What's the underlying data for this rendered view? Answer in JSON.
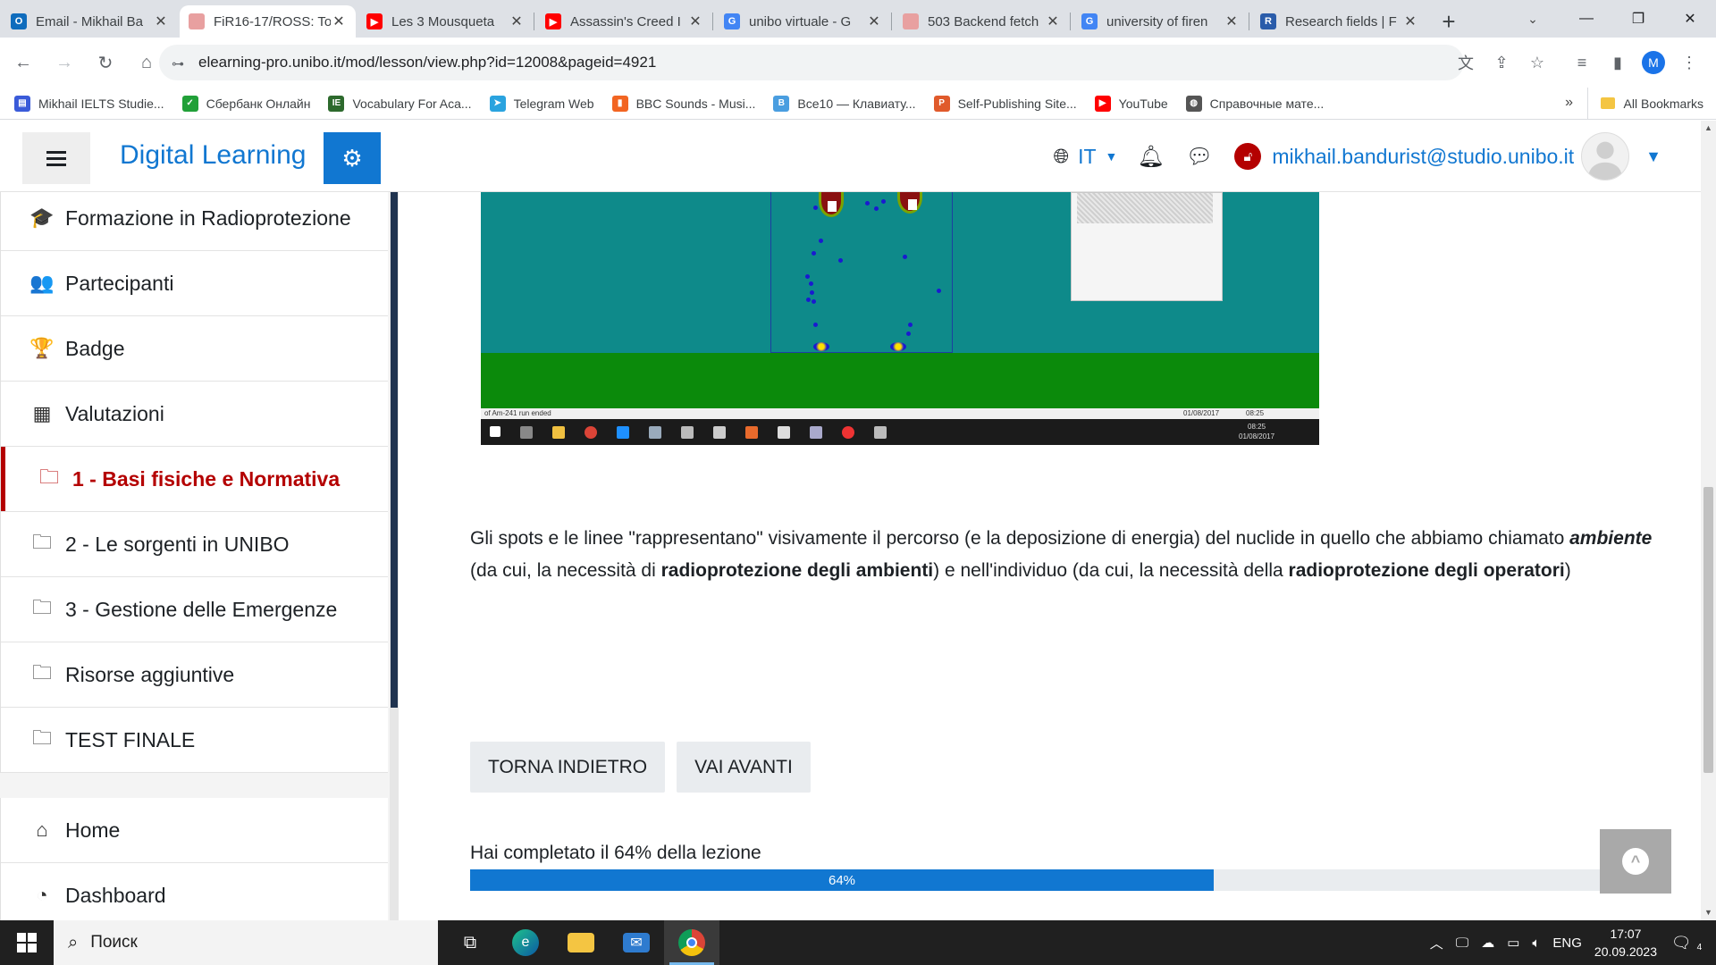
{
  "browser": {
    "tabs": [
      {
        "title": "Email - Mikhail Ba",
        "favicon_color": "#0f6cbd",
        "favicon_letter": "O",
        "active": false
      },
      {
        "title": "FiR16-17/ROSS: To",
        "favicon_color": "#e8a0a0",
        "favicon_letter": "",
        "active": true
      },
      {
        "title": "Les 3 Mousqueta",
        "favicon_color": "#ff0000",
        "favicon_letter": "▶",
        "active": false
      },
      {
        "title": "Assassin's Creed I",
        "favicon_color": "#ff0000",
        "favicon_letter": "▶",
        "active": false
      },
      {
        "title": "unibo virtuale - G",
        "favicon_color": "#4285f4",
        "favicon_letter": "G",
        "active": false
      },
      {
        "title": "503 Backend fetch",
        "favicon_color": "#e8a0a0",
        "favicon_letter": "",
        "active": false
      },
      {
        "title": "university of firen",
        "favicon_color": "#4285f4",
        "favicon_letter": "G",
        "active": false
      },
      {
        "title": "Research fields | F",
        "favicon_color": "#2a5caa",
        "favicon_letter": "R",
        "active": false
      }
    ],
    "new_tab": "+",
    "window_controls": {
      "minimize": "—",
      "maximize": "❐",
      "close": "✕"
    },
    "url": "elearning-pro.unibo.it/mod/lesson/view.php?id=12008&pageid=4921",
    "profile_letter": "M",
    "bookmarks": [
      {
        "label": "Mikhail IELTS Studie...",
        "color": "#3a5bd9",
        "glyph": "▤"
      },
      {
        "label": "Сбербанк Онлайн",
        "color": "#21a038",
        "glyph": "✓"
      },
      {
        "label": "Vocabulary For Aca...",
        "color": "#2d6a2d",
        "glyph": "IE"
      },
      {
        "label": "Telegram Web",
        "color": "#2aa3df",
        "glyph": "➤"
      },
      {
        "label": "BBC Sounds - Musi...",
        "color": "#f26522",
        "glyph": "▮"
      },
      {
        "label": "Все10 — Клавиату...",
        "color": "#4a9ee0",
        "glyph": "B"
      },
      {
        "label": "Self-Publishing Site...",
        "color": "#e05a2b",
        "glyph": "P"
      },
      {
        "label": "YouTube",
        "color": "#ff0000",
        "glyph": "▶"
      },
      {
        "label": "Справочные мате...",
        "color": "#555555",
        "glyph": "◍"
      }
    ],
    "bookmarks_more": "»",
    "all_bookmarks": "All Bookmarks"
  },
  "header": {
    "site_name": "Digital Learning",
    "language": "IT",
    "user_email": "mikhail.bandurist@studio.unibo.it",
    "accent_color": "#1177d1"
  },
  "sidebar": {
    "items": [
      {
        "label": "Formazione in Radioprotezione",
        "icon": "graduation-cap-icon",
        "glyph": "🎓",
        "active": false
      },
      {
        "label": "Partecipanti",
        "icon": "users-icon",
        "glyph": "👥",
        "active": false
      },
      {
        "label": "Badge",
        "icon": "trophy-icon",
        "glyph": "🏆",
        "active": false
      },
      {
        "label": "Valutazioni",
        "icon": "table-icon",
        "glyph": "▦",
        "active": false
      },
      {
        "label": "1 - Basi fisiche e Normativa",
        "icon": "folder-icon",
        "glyph": "🗀",
        "active": true
      },
      {
        "label": "2 - Le sorgenti in UNIBO",
        "icon": "folder-icon",
        "glyph": "🗀",
        "active": false
      },
      {
        "label": "3 - Gestione delle Emergenze",
        "icon": "folder-icon",
        "glyph": "🗀",
        "active": false
      },
      {
        "label": "Risorse aggiuntive",
        "icon": "folder-icon",
        "glyph": "🗀",
        "active": false
      },
      {
        "label": "TEST FINALE",
        "icon": "folder-icon",
        "glyph": "🗀",
        "active": false
      }
    ],
    "items2": [
      {
        "label": "Home",
        "icon": "home-icon",
        "glyph": "⌂"
      },
      {
        "label": "Dashboard",
        "icon": "dashboard-icon",
        "glyph": "◔"
      }
    ]
  },
  "simulation": {
    "status_text": "of Am-241   run ended",
    "date1": "01/08/2017",
    "time1": "08:25",
    "clock_time": "08:25",
    "clock_date": "01/08/2017"
  },
  "lesson": {
    "p1": "Gli spots e le linee \"rappresentano\" visivamente il percorso (e la deposizione di energia) del nuclide in quello che abbiamo chiamato ",
    "em1": "ambiente",
    "p2": " (da cui, la necessità di ",
    "b1": "radioprotezione degli ambienti",
    "p3": ") e nell'individuo (da cui, la necessità della ",
    "b2": "radioprotezione degli operatori",
    "p4": ")",
    "back_button": "TORNA INDIETRO",
    "next_button": "VAI AVANTI",
    "progress_label": "Hai completato il 64% della lezione",
    "progress_value": 64,
    "progress_text": "64%"
  },
  "taskbar": {
    "search_placeholder": "Поиск",
    "language": "ENG",
    "time": "17:07",
    "date": "20.09.2023",
    "notifications": "4"
  }
}
